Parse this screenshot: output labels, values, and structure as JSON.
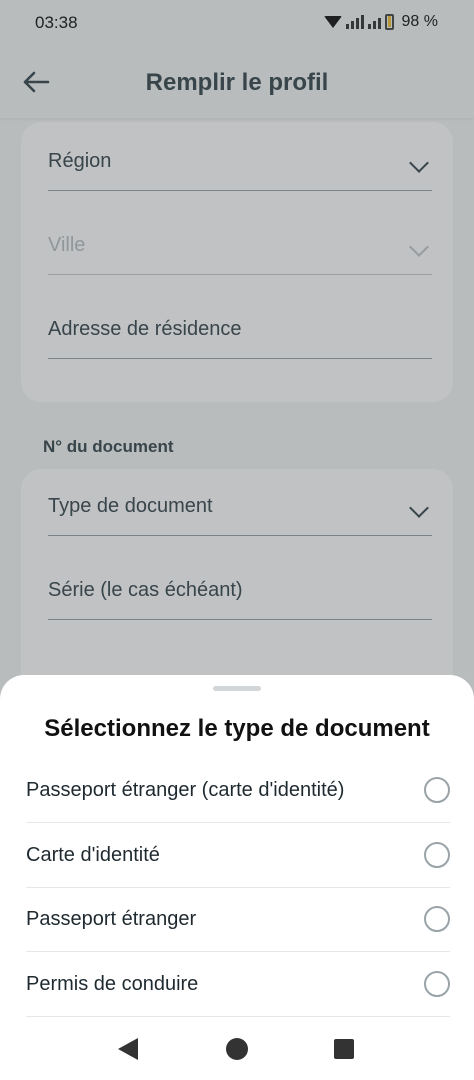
{
  "status_bar": {
    "time": "03:38",
    "battery_percent": "98 %",
    "icons": [
      "wifi-icon",
      "signal-icon",
      "battery-icon"
    ]
  },
  "app_bar": {
    "title": "Remplir le profil",
    "back_icon": "arrow-left-icon"
  },
  "form": {
    "card1": {
      "region": {
        "label": "Région"
      },
      "ville": {
        "label": "Ville"
      },
      "adresse": {
        "label": "Adresse de résidence"
      }
    },
    "section_label": "N° du document",
    "card2": {
      "type_document": {
        "label": "Type de document"
      },
      "serie": {
        "label": "Série (le cas échéant)"
      }
    }
  },
  "sheet": {
    "title": "Sélectionnez le type de document",
    "options": [
      {
        "label": "Passeport étranger (carte d'identité)",
        "selected": false
      },
      {
        "label": "Carte d'identité",
        "selected": false
      },
      {
        "label": "Passeport étranger",
        "selected": false
      },
      {
        "label": "Permis de conduire",
        "selected": false
      }
    ]
  },
  "nav_bar": {
    "icons": [
      "nav-back-icon",
      "nav-home-icon",
      "nav-recents-icon"
    ]
  },
  "colors": {
    "text_primary": "#37474f",
    "sheet_bg": "#ffffff",
    "page_bg": "#f4f6f7"
  }
}
